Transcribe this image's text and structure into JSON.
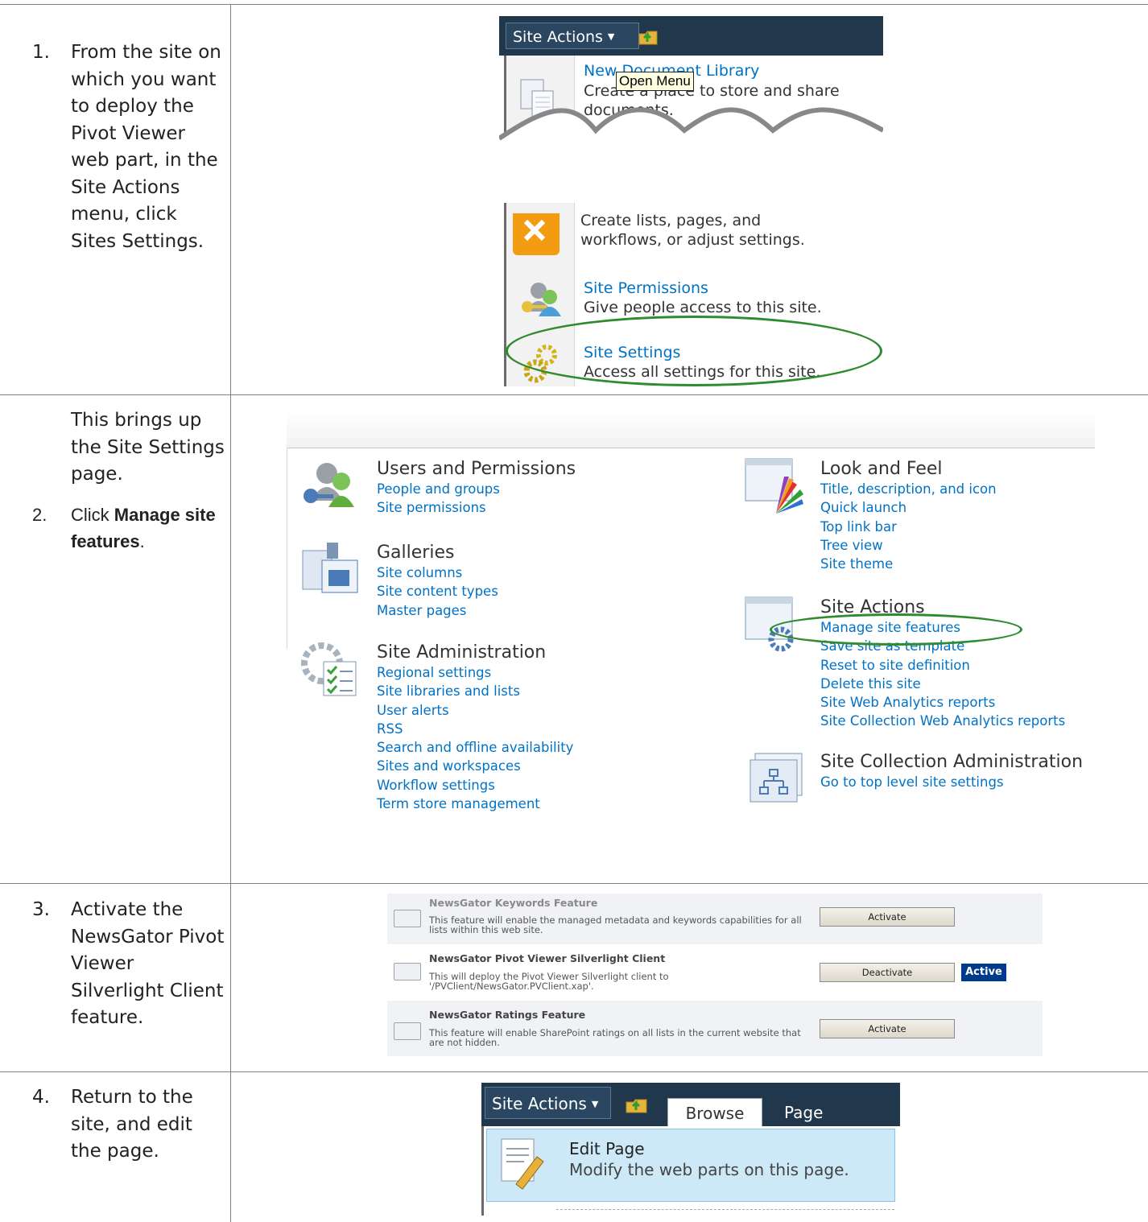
{
  "steps": [
    {
      "num": "1.",
      "text": "From the site on which you want to deploy the Pivot Viewer web part, in the Site Actions menu, click Sites Settings."
    },
    {
      "intro": "This brings up the Site Settings page.",
      "num": "2.",
      "text_pre": "Click ",
      "text_bold": "Manage site features",
      "text_post": "."
    },
    {
      "num": "3.",
      "text": "Activate the NewsGator Pivot Viewer Silverlight Client feature."
    },
    {
      "num": "4.",
      "text": "Return to the site, and edit the page."
    }
  ],
  "site_actions_menu": {
    "button_label": "Site Actions",
    "tooltip": "Open Menu",
    "items": [
      {
        "title": "New Document Library",
        "desc": "Create a place to store and share documents."
      },
      {
        "title": "",
        "desc_partial_1": "Create lists, pages, and",
        "desc_partial_2": "workflows, or adjust settings."
      },
      {
        "title": "Site Permissions",
        "desc": "Give people access to this site."
      },
      {
        "title": "Site Settings",
        "desc": "Access all settings for this site."
      }
    ]
  },
  "site_settings": {
    "sections_left": [
      {
        "title": "Users and Permissions",
        "links": [
          "People and groups",
          "Site permissions"
        ]
      },
      {
        "title": "Galleries",
        "links": [
          "Site columns",
          "Site content types",
          "Master pages"
        ]
      },
      {
        "title": "Site Administration",
        "links": [
          "Regional settings",
          "Site libraries and lists",
          "User alerts",
          "RSS",
          "Search and offline availability",
          "Sites and workspaces",
          "Workflow settings",
          "Term store management"
        ]
      }
    ],
    "sections_right": [
      {
        "title": "Look and Feel",
        "links": [
          "Title, description, and icon",
          "Quick launch",
          "Top link bar",
          "Tree view",
          "Site theme"
        ]
      },
      {
        "title": "Site Actions",
        "links": [
          "Manage site features",
          "Save site as template",
          "Reset to site definition",
          "Delete this site",
          "Site Web Analytics reports",
          "Site Collection Web Analytics reports"
        ]
      },
      {
        "title": "Site Collection Administration",
        "links": [
          "Go to top level site settings"
        ]
      }
    ]
  },
  "features": [
    {
      "title": "NewsGator Keywords Feature",
      "desc": "This feature will enable the managed metadata and keywords capabilities for all lists within this web site.",
      "button": "Activate",
      "status": ""
    },
    {
      "title": "NewsGator Pivot Viewer Silverlight Client",
      "desc": "This will deploy the Pivot Viewer Silverlight client to '/PVClient/NewsGator.PVClient.xap'.",
      "button": "Deactivate",
      "status": "Active"
    },
    {
      "title": "NewsGator Ratings Feature",
      "desc": "This feature will enable SharePoint ratings on all lists in the current website that are not hidden.",
      "button": "Activate",
      "status": ""
    }
  ],
  "ribbon": {
    "button_label": "Site Actions",
    "tabs": [
      "Browse",
      "Page"
    ],
    "item_title": "Edit Page",
    "item_desc": "Modify the web parts on this page."
  },
  "colors": {
    "link": "#0072c6",
    "ribbon_bar": "#21374c",
    "highlight_ellipse": "#2e8b2e",
    "active_badge": "#003a8c"
  }
}
